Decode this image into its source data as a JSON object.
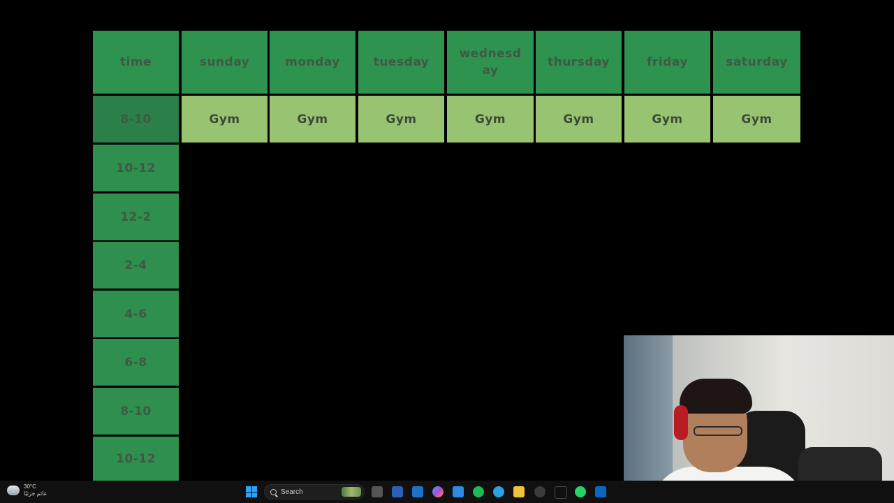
{
  "schedule": {
    "header": {
      "time": "time",
      "days": [
        "sunday",
        "monday",
        "tuesday",
        "wednesday",
        "thursday",
        "friday",
        "saturday"
      ]
    },
    "rows": [
      {
        "time": "8-10",
        "cells": [
          "Gym",
          "Gym",
          "Gym",
          "Gym",
          "Gym",
          "Gym",
          "Gym"
        ]
      },
      {
        "time": "10-12",
        "cells": []
      },
      {
        "time": "12-2",
        "cells": []
      },
      {
        "time": "2-4",
        "cells": []
      },
      {
        "time": "4-6",
        "cells": []
      },
      {
        "time": "6-8",
        "cells": []
      },
      {
        "time": "8-10",
        "cells": []
      },
      {
        "time": "10-12",
        "cells": []
      }
    ]
  },
  "taskbar": {
    "weather": {
      "temp": "30°C",
      "condition": "غائم جزئيًا"
    },
    "search": {
      "placeholder": "Search"
    }
  },
  "colors": {
    "header_green": "#2f9350",
    "time_green": "#2e8f4f",
    "gym_light_green": "#98c472"
  }
}
